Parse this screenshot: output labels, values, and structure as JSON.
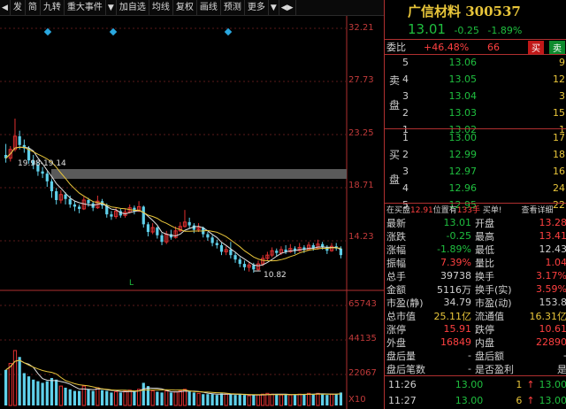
{
  "toolbar": {
    "items": [
      "发",
      "简",
      "九转",
      "重大事件",
      "加自选",
      "均线",
      "复权",
      "画线",
      "预测",
      "更多"
    ],
    "colors": {
      "up": "#e03030",
      "down": "#1fbf3f",
      "accent": "#e8c53a"
    }
  },
  "chart": {
    "price_axis": [
      "32.21",
      "27.73",
      "23.25",
      "18.71",
      "14.23"
    ],
    "volume_axis": [
      "65743",
      "44135",
      "22067",
      "X10"
    ],
    "range_label": "19.98-19.14",
    "low_label": "10.82",
    "marker_label": "L"
  },
  "chart_data": {
    "type": "candlestick",
    "ylim": [
      10,
      33
    ],
    "candles": [
      [
        21.5,
        21.2,
        22.5,
        20.8
      ],
      [
        21.2,
        22.0,
        22.3,
        20.9
      ],
      [
        22.0,
        23.2,
        24.8,
        21.8
      ],
      [
        23.2,
        22.4,
        23.7,
        22.0
      ],
      [
        22.4,
        22.1,
        22.9,
        21.7
      ],
      [
        22.1,
        21.0,
        22.3,
        20.7
      ],
      [
        21.0,
        20.6,
        21.5,
        20.2
      ],
      [
        20.6,
        20.0,
        20.9,
        19.6
      ],
      [
        20.0,
        19.8,
        20.4,
        19.4
      ],
      [
        19.8,
        19.1,
        20.0,
        18.6
      ],
      [
        19.1,
        18.2,
        19.3,
        17.6
      ],
      [
        18.2,
        17.4,
        18.5,
        17.0
      ],
      [
        17.4,
        17.9,
        18.3,
        17.1
      ],
      [
        17.9,
        17.5,
        18.1,
        17.0
      ],
      [
        17.5,
        17.0,
        17.8,
        16.7
      ],
      [
        17.0,
        16.8,
        17.3,
        16.4
      ],
      [
        16.8,
        16.6,
        17.0,
        16.2
      ],
      [
        16.6,
        17.4,
        17.7,
        16.5
      ],
      [
        17.4,
        17.1,
        17.6,
        16.8
      ],
      [
        17.1,
        16.7,
        17.3,
        16.4
      ],
      [
        16.7,
        17.3,
        17.8,
        16.6
      ],
      [
        17.3,
        16.9,
        17.5,
        16.6
      ],
      [
        16.9,
        16.1,
        17.1,
        15.8
      ],
      [
        16.1,
        15.9,
        16.4,
        15.6
      ],
      [
        15.9,
        16.4,
        16.7,
        15.7
      ],
      [
        16.4,
        16.0,
        16.6,
        15.8
      ],
      [
        16.0,
        16.3,
        16.6,
        15.8
      ],
      [
        16.3,
        16.7,
        17.0,
        16.2
      ],
      [
        16.7,
        16.4,
        16.9,
        16.1
      ],
      [
        16.4,
        16.8,
        17.3,
        16.3
      ],
      [
        16.8,
        15.2,
        16.9,
        14.9
      ],
      [
        15.2,
        14.5,
        15.4,
        14.1
      ],
      [
        14.5,
        14.9,
        15.3,
        14.3
      ],
      [
        14.9,
        14.2,
        15.0,
        13.9
      ],
      [
        14.2,
        13.6,
        14.4,
        13.3
      ],
      [
        13.6,
        14.3,
        14.6,
        13.4
      ],
      [
        14.3,
        14.0,
        14.7,
        13.8
      ],
      [
        14.0,
        14.6,
        15.0,
        13.9
      ],
      [
        14.6,
        15.0,
        15.4,
        14.5
      ],
      [
        15.0,
        15.4,
        16.5,
        14.9
      ],
      [
        15.4,
        15.1,
        15.8,
        14.8
      ],
      [
        15.1,
        14.7,
        15.3,
        14.4
      ],
      [
        14.7,
        14.9,
        15.3,
        14.5
      ],
      [
        14.9,
        14.3,
        15.0,
        14.0
      ],
      [
        14.3,
        14.0,
        14.5,
        13.7
      ],
      [
        14.0,
        13.5,
        14.2,
        13.2
      ],
      [
        13.5,
        13.3,
        13.8,
        13.0
      ],
      [
        13.3,
        12.7,
        13.5,
        12.4
      ],
      [
        12.7,
        12.9,
        13.2,
        12.4
      ],
      [
        12.9,
        12.4,
        13.6,
        12.1
      ],
      [
        12.4,
        12.0,
        12.6,
        11.7
      ],
      [
        12.0,
        11.6,
        12.2,
        11.3
      ],
      [
        11.6,
        11.3,
        11.9,
        11.0
      ],
      [
        11.3,
        11.5,
        11.8,
        10.9
      ],
      [
        11.5,
        11.1,
        11.7,
        10.8
      ],
      [
        11.1,
        11.6,
        11.9,
        11.0
      ],
      [
        11.6,
        12.1,
        12.4,
        11.4
      ],
      [
        12.1,
        12.4,
        12.7,
        11.9
      ],
      [
        12.4,
        12.8,
        13.1,
        12.2
      ],
      [
        12.8,
        12.6,
        13.0,
        12.3
      ],
      [
        12.6,
        12.9,
        13.2,
        12.4
      ],
      [
        12.9,
        12.7,
        13.3,
        12.5
      ],
      [
        12.7,
        13.0,
        13.4,
        12.6
      ],
      [
        13.0,
        12.8,
        13.2,
        12.5
      ],
      [
        12.8,
        13.1,
        13.5,
        12.7
      ],
      [
        13.1,
        12.9,
        13.3,
        12.6
      ],
      [
        12.9,
        13.3,
        13.6,
        12.8
      ],
      [
        13.3,
        13.0,
        13.5,
        12.8
      ],
      [
        13.0,
        13.4,
        13.8,
        12.9
      ],
      [
        13.4,
        13.1,
        13.6,
        12.9
      ],
      [
        13.1,
        12.8,
        13.3,
        12.5
      ],
      [
        12.8,
        13.2,
        13.5,
        12.7
      ],
      [
        13.2,
        13.0,
        13.5,
        12.8
      ],
      [
        13.0,
        12.4,
        13.2,
        12.1
      ]
    ],
    "volumes": [
      22000,
      26000,
      34000,
      30000,
      20000,
      18000,
      16000,
      15000,
      14000,
      15000,
      17000,
      16000,
      12000,
      11000,
      10000,
      9000,
      9000,
      12000,
      10000,
      9000,
      11000,
      9500,
      9000,
      8000,
      8500,
      8000,
      9000,
      9500,
      8500,
      10000,
      14000,
      12000,
      9000,
      8500,
      8000,
      9000,
      8000,
      8500,
      9000,
      10000,
      8500,
      8000,
      7500,
      7000,
      7000,
      7000,
      6500,
      7500,
      7000,
      7000,
      6500,
      7000,
      6500,
      6000,
      6500,
      6500,
      7000,
      7500,
      7000,
      7000,
      6500,
      7000,
      6500,
      6500,
      7000,
      7000,
      7500,
      7000,
      7500,
      7000,
      6500,
      7000,
      7000,
      8000
    ],
    "vol_max": 65743,
    "ma_lines": [
      {
        "name": "MA5",
        "color": "#e0e0e0"
      },
      {
        "name": "MA10",
        "color": "#e8c53a"
      }
    ]
  },
  "panel": {
    "title": "广信材料 300537",
    "price": "13.01",
    "change": "-0.25",
    "change_pct": "-1.89%",
    "weibi_label": "委比",
    "weibi_value": "+46.48%",
    "weibi_diff": "66",
    "buy_btn": "买",
    "sell_btn": "卖",
    "sell_label": [
      "卖",
      "盘"
    ],
    "buy_label": [
      "买",
      "盘"
    ],
    "asks": [
      {
        "level": "5",
        "price": "13.06",
        "vol": "9"
      },
      {
        "level": "4",
        "price": "13.05",
        "vol": "12"
      },
      {
        "level": "3",
        "price": "13.04",
        "vol": "3"
      },
      {
        "level": "2",
        "price": "13.03",
        "vol": "15"
      },
      {
        "level": "1",
        "price": "13.02",
        "vol": "1"
      }
    ],
    "bids": [
      {
        "level": "1",
        "price": "13.00",
        "vol": "17"
      },
      {
        "level": "2",
        "price": "12.99",
        "vol": "18"
      },
      {
        "level": "3",
        "price": "12.97",
        "vol": "16"
      },
      {
        "level": "4",
        "price": "12.96",
        "vol": "24"
      },
      {
        "level": "5",
        "price": "12.95",
        "vol": "22"
      }
    ],
    "notice_pre": "在买盘",
    "notice_price": "12.91",
    "notice_mid": "位置有",
    "notice_qty": "133手",
    "notice_post": " 买单!",
    "notice_link": "查看详细",
    "stats": [
      {
        "k": "最新",
        "v": "13.01",
        "k2": "开盘",
        "v2": "13.28"
      },
      {
        "k": "涨跌",
        "v": "-0.25",
        "k2": "最高",
        "v2": "13.41"
      },
      {
        "k": "涨幅",
        "v": "-1.89%",
        "k2": "最低",
        "v2": "12.43"
      },
      {
        "k": "振幅",
        "v": "7.39%",
        "k2": "量比",
        "v2": "1.04"
      },
      {
        "k": "总手",
        "v": "39738",
        "k2": "换手",
        "v2": "3.17%"
      },
      {
        "k": "金额",
        "v": "5116万",
        "k2": "换手(实)",
        "v2": "3.59%"
      },
      {
        "k": "市盈(静)",
        "v": "34.79",
        "k2": "市盈(动)",
        "v2": "153.8"
      },
      {
        "k": "总市值",
        "v": "25.11亿",
        "k2": "流通值",
        "v2": "16.31亿"
      },
      {
        "k": "涨停",
        "v": "15.91",
        "k2": "跌停",
        "v2": "10.61"
      },
      {
        "k": "外盘",
        "v": "16849",
        "k2": "内盘",
        "v2": "22890"
      },
      {
        "k": "盘后量",
        "v": "-",
        "k2": "盘后额",
        "v2": "-"
      },
      {
        "k": "盘后笔数",
        "v": "-",
        "k2": "是否盈利",
        "v2": "是"
      }
    ],
    "trades": [
      {
        "time": "11:26",
        "price": "13.00",
        "qty": "1",
        "arrow": "↑",
        "p2": "13.00"
      },
      {
        "time": "11:27",
        "price": "13.00",
        "qty": "6",
        "arrow": "↑",
        "p2": "13.00"
      }
    ]
  }
}
